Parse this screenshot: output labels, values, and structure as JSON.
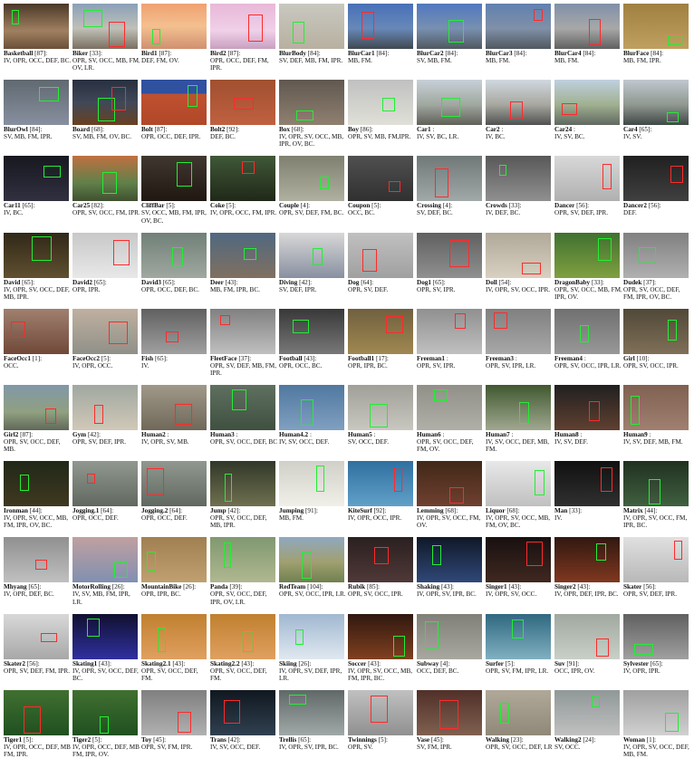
{
  "colors": {
    "box_green": "#22ee33",
    "box_red": "#ff2a2a"
  },
  "sequences": [
    {
      "name": "Basketball",
      "frames": "[87]:",
      "attrs": "IV, OPR, OCC, DEF, BC.",
      "bg": "linear-gradient(#4a3828,#a08060 60%,#6a5038)",
      "boxes": [
        "green"
      ]
    },
    {
      "name": "Biker",
      "frames": "[33]:",
      "attrs": "OPR, SV, OCC, MB, FM, OV, LR.",
      "bg": "linear-gradient(#8aa0b8,#c0c0b8 55%,#7a7060)",
      "boxes": [
        "green",
        "red"
      ]
    },
    {
      "name": "Bird1",
      "frames": "[87]:",
      "attrs": "DEF, FM, OV.",
      "bg": "linear-gradient(#f0a070,#f4c090 50%,#d09070)",
      "boxes": [
        "green"
      ]
    },
    {
      "name": "Bird2",
      "frames": "[87]:",
      "attrs": "OPR, OCC, DEF, FM, IPR.",
      "bg": "linear-gradient(#e8b8d8,#f0d0e8 60%,#c8a0c0)",
      "boxes": [
        "red"
      ]
    },
    {
      "name": "BlurBody",
      "frames": "[84]:",
      "attrs": "SV, DEF, MB, FM, IPR.",
      "bg": "linear-gradient(#c8c8c0,#b8b0a0)",
      "boxes": [
        "green"
      ]
    },
    {
      "name": "BlurCar1",
      "frames": "[84]:",
      "attrs": "MB, FM.",
      "bg": "linear-gradient(#4870b8,#6888b8 55%,#404850)",
      "boxes": [
        "red"
      ]
    },
    {
      "name": "BlurCar2",
      "frames": "[84]:",
      "attrs": "SV, MB, FM.",
      "bg": "linear-gradient(#5078c0,#7890b0 55%,#505860)",
      "boxes": [
        "green"
      ]
    },
    {
      "name": "BlurCar3",
      "frames": "[84]:",
      "attrs": "MB, FM.",
      "bg": "linear-gradient(#6080b0,#8090a8 55%,#505860)",
      "boxes": [
        "red"
      ]
    },
    {
      "name": "BlurCar4",
      "frames": "[84]:",
      "attrs": "MB, FM.",
      "bg": "linear-gradient(#8090a8,#a8a8a8 55%,#606060)",
      "boxes": [
        "red"
      ]
    },
    {
      "name": "BlurFace",
      "frames": "[84]:",
      "attrs": "MB, FM, IPR.",
      "bg": "linear-gradient(#a08040,#c0a060)",
      "boxes": [
        "green"
      ]
    },
    {
      "name": "BlurOwl",
      "frames": "[84]:",
      "attrs": "SV, MB, FM, IPR.",
      "bg": "linear-gradient(#606870,#8890a0)",
      "boxes": [
        "green"
      ]
    },
    {
      "name": "Board",
      "frames": "[68]:",
      "attrs": "SV, MB, FM, OV, BC.",
      "bg": "linear-gradient(#283040,#404858 50%,#6a4020)",
      "boxes": [
        "green",
        "red"
      ]
    },
    {
      "name": "Bolt",
      "frames": "[87]:",
      "attrs": "OPR, OCC, DEF, IPR.",
      "bg": "linear-gradient(#3050a0 30%,#c05030 32%,#b04828)",
      "boxes": [
        "green"
      ]
    },
    {
      "name": "Bolt2",
      "frames": "[92]:",
      "attrs": "DEF, BC.",
      "bg": "linear-gradient(#a05030,#c06040)",
      "boxes": [
        "red"
      ]
    },
    {
      "name": "Box",
      "frames": "[68]:",
      "attrs": "IV, OPR, SV, OCC, MB, IPR, OV, BC.",
      "bg": "linear-gradient(#605850,#908070)",
      "boxes": [
        "green"
      ]
    },
    {
      "name": "Boy",
      "frames": "[86]:",
      "attrs": "OPR, SV, MB, FM,IPR.",
      "bg": "linear-gradient(#c0c0c0,#e0e0d8)",
      "boxes": [
        "green"
      ]
    },
    {
      "name": "Car1",
      "frames": ":",
      "attrs": "IV, SV, BC, LR.",
      "bg": "linear-gradient(#c8d0d8,#a0a8a0 55%,#606058)",
      "boxes": [
        "green"
      ]
    },
    {
      "name": "Car2",
      "frames": ":",
      "attrs": "IV, BC.",
      "bg": "linear-gradient(#d0d8e0,#a8a8a0 55%,#505050)",
      "boxes": [
        "red"
      ]
    },
    {
      "name": "Car24",
      "frames": ":",
      "attrs": "IV, SV, BC.",
      "bg": "linear-gradient(#c0d0e0,#a0b090 55%,#606860)",
      "boxes": [
        "red"
      ]
    },
    {
      "name": "Car4",
      "frames": "[65]:",
      "attrs": "IV, SV.",
      "bg": "linear-gradient(#c0c8d0,#909890 55%,#404848)",
      "boxes": [
        "green"
      ]
    },
    {
      "name": "Car11",
      "frames": "[65]:",
      "attrs": "IV, BC.",
      "bg": "linear-gradient(#181820,#303040)",
      "boxes": [
        "green"
      ]
    },
    {
      "name": "Car25",
      "frames": "[82]:",
      "attrs": "OPR, SV, OCC, FM, IPR.",
      "bg": "linear-gradient(#c07040,#60804a 60%,#405030)",
      "boxes": [
        "green"
      ]
    },
    {
      "name": "CliffBar",
      "frames": "[5]:",
      "attrs": "SV, OCC, MB, FM, IPR, OV, BC.",
      "bg": "linear-gradient(#403830,#201810)",
      "boxes": [
        "green"
      ]
    },
    {
      "name": "Coke",
      "frames": "[5]:",
      "attrs": "IV, OPR, OCC, FM, IPR.",
      "bg": "linear-gradient(#405838,#202818)",
      "boxes": [
        "red"
      ]
    },
    {
      "name": "Couple",
      "frames": "[4]:",
      "attrs": "OPR, SV, DEF, FM, BC.",
      "bg": "linear-gradient(#808070,#b0b0a0)",
      "boxes": [
        "green"
      ]
    },
    {
      "name": "Coupon",
      "frames": "[5]:",
      "attrs": "OCC, BC.",
      "bg": "linear-gradient(#505050,#303030)",
      "boxes": [
        "red"
      ]
    },
    {
      "name": "Crossing",
      "frames": "[4]:",
      "attrs": "SV, DEF, BC.",
      "bg": "linear-gradient(#707878,#a0a8a8)",
      "boxes": [
        "red"
      ]
    },
    {
      "name": "Crowds",
      "frames": "[33]:",
      "attrs": "IV, DEF, BC.",
      "bg": "linear-gradient(#585858,#909090)",
      "boxes": [
        "green"
      ]
    },
    {
      "name": "Dancer",
      "frames": "[56]:",
      "attrs": "OPR, SV, DEF, IPR.",
      "bg": "linear-gradient(#d8d8d8,#b0b0b0)",
      "boxes": [
        "red"
      ]
    },
    {
      "name": "Dancer2",
      "frames": "[56]:",
      "attrs": "DEF.",
      "bg": "linear-gradient(#202020,#404040)",
      "boxes": [
        "red"
      ]
    },
    {
      "name": "David",
      "frames": "[65]:",
      "attrs": "IV, OPR, SV, OCC, DEF, MB, IPR.",
      "bg": "linear-gradient(#302818,#605030)",
      "boxes": [
        "green"
      ]
    },
    {
      "name": "David2",
      "frames": "[65]:",
      "attrs": "OPR, IPR.",
      "bg": "linear-gradient(#c8c8c8,#e8e8e8)",
      "boxes": [
        "red"
      ]
    },
    {
      "name": "David3",
      "frames": "[65]:",
      "attrs": "OPR, OCC, DEF, BC.",
      "bg": "linear-gradient(#708078,#a0a8a0)",
      "boxes": [
        "green"
      ]
    },
    {
      "name": "Deer",
      "frames": "[43]:",
      "attrs": "MB, FM, IPR, BC.",
      "bg": "linear-gradient(#506880,#807060)",
      "boxes": [
        "green"
      ]
    },
    {
      "name": "Diving",
      "frames": "[42]:",
      "attrs": "SV, DEF, IPR.",
      "bg": "linear-gradient(#d8d8d8,#8890a0)",
      "boxes": [
        "green"
      ]
    },
    {
      "name": "Dog",
      "frames": "[64]:",
      "attrs": "OPR, SV, DEF.",
      "bg": "linear-gradient(#c0c0c0,#a0a0a0)",
      "boxes": [
        "red"
      ]
    },
    {
      "name": "Dog1",
      "frames": "[65]:",
      "attrs": "OPR, SV, IPR.",
      "bg": "linear-gradient(#606060,#909090)",
      "boxes": [
        "red"
      ]
    },
    {
      "name": "Doll",
      "frames": "[54]:",
      "attrs": "IV, OPR, SV, OCC, IPR.",
      "bg": "linear-gradient(#b0a898,#d8d0c0)",
      "boxes": [
        "red"
      ]
    },
    {
      "name": "DragonBaby",
      "frames": "[33]:",
      "attrs": "OPR, SV, OCC, MB, FM, IPR, OV.",
      "bg": "linear-gradient(#407030,#80a040)",
      "boxes": [
        "green"
      ]
    },
    {
      "name": "Dudek",
      "frames": "[37]:",
      "attrs": "OPR, SV, OCC, DEF, FM, IPR, OV, BC.",
      "bg": "linear-gradient(#808080,#b0b0b0)",
      "boxes": [
        "green"
      ]
    },
    {
      "name": "FaceOcc1",
      "frames": "[1]:",
      "attrs": "OCC.",
      "bg": "linear-gradient(#a08070,#704838)",
      "boxes": [
        "red"
      ]
    },
    {
      "name": "FaceOcc2",
      "frames": "[5]:",
      "attrs": "IV, OPR, OCC.",
      "bg": "linear-gradient(#c0b0a0,#909088)",
      "boxes": [
        "red"
      ]
    },
    {
      "name": "Fish",
      "frames": "[65]:",
      "attrs": "IV.",
      "bg": "linear-gradient(#606060,#a0a0a0)",
      "boxes": [
        "red"
      ]
    },
    {
      "name": "FleetFace",
      "frames": "[37]:",
      "attrs": "OPR, SV, DEF, MB, FM, IPR.",
      "bg": "linear-gradient(#808080,#c0c0c0)",
      "boxes": [
        "red"
      ]
    },
    {
      "name": "Football",
      "frames": "[43]:",
      "attrs": "OPR, OCC, BC.",
      "bg": "linear-gradient(#383838,#787878)",
      "boxes": [
        "green"
      ]
    },
    {
      "name": "Football1",
      "frames": "[17]:",
      "attrs": "OPR, IPR, BC.",
      "bg": "linear-gradient(#706040,#a08850)",
      "boxes": [
        "red"
      ]
    },
    {
      "name": "Freeman1",
      "frames": ":",
      "attrs": "OPR, SV, IPR.",
      "bg": "linear-gradient(#909090,#c0c0c0)",
      "boxes": [
        "red"
      ]
    },
    {
      "name": "Freeman3",
      "frames": ":",
      "attrs": "OPR, SV, IPR, LR.",
      "bg": "linear-gradient(#808080,#a8a8a8)",
      "boxes": [
        "red"
      ]
    },
    {
      "name": "Freeman4",
      "frames": ":",
      "attrs": "OPR, SV, OCC, IPR, LR.",
      "bg": "linear-gradient(#707070,#989898)",
      "boxes": [
        "green"
      ]
    },
    {
      "name": "Girl",
      "frames": "[10]:",
      "attrs": "OPR, SV, OCC, IPR.",
      "bg": "linear-gradient(#504838,#807058)",
      "boxes": [
        "green"
      ]
    },
    {
      "name": "Girl2",
      "frames": "[87]:",
      "attrs": "OPR, SV, OCC, DEF, MB.",
      "bg": "linear-gradient(#8098a8,#90a080 60%,#606858)",
      "boxes": [
        "red"
      ]
    },
    {
      "name": "Gym",
      "frages": "",
      "frames": "[42]:",
      "attrs": "OPR, SV, DEF, IPR.",
      "bg": "linear-gradient(#a0a8a0,#d0c8b8)",
      "boxes": [
        "red"
      ]
    },
    {
      "name": "Human2",
      "frames": ":",
      "attrs": "IV, OPR, SV, MB.",
      "bg": "linear-gradient(#a09888,#706858)",
      "boxes": [
        "red"
      ]
    },
    {
      "name": "Human3",
      "frames": ":",
      "attrs": "OPR, SV, OCC, DEF, BC.",
      "bg": "linear-gradient(#607060,#405040)",
      "boxes": [
        "green"
      ]
    },
    {
      "name": "Human4.2",
      "frames": ":",
      "attrs": "IV, SV, OCC, DEF.",
      "bg": "linear-gradient(#5078a0,#80a0c0)",
      "boxes": [
        "green"
      ]
    },
    {
      "name": "Human5",
      "frames": ":",
      "attrs": "SV, OCC, DEF.",
      "bg": "linear-gradient(#a0a098,#c8c8c0)",
      "boxes": [
        "green"
      ]
    },
    {
      "name": "Human6",
      "frames": ":",
      "attrs": "OPR, SV, OCC, DEF, FM, OV.",
      "bg": "linear-gradient(#909088,#b0b0a8)",
      "boxes": [
        "green"
      ]
    },
    {
      "name": "Human7",
      "frames": ":",
      "attrs": "IV, SV, OCC, DEF, MB, FM.",
      "bg": "linear-gradient(#405830,#a0a890)",
      "boxes": [
        "green"
      ]
    },
    {
      "name": "Human8",
      "frames": ":",
      "attrs": "IV, SV, DEF.",
      "bg": "linear-gradient(#202020,#604030)",
      "boxes": [
        "red"
      ]
    },
    {
      "name": "Human9",
      "frames": ":",
      "attrs": "IV, SV, DEF, MB, FM.",
      "bg": "linear-gradient(#806050,#a08070)",
      "boxes": [
        "green"
      ]
    },
    {
      "name": "Ironman",
      "frames": "[44]:",
      "attrs": "IV, OPR, SV, OCC, MB, FM, IPR, OV, BC.",
      "bg": "linear-gradient(#202818,#403820)",
      "boxes": [
        "green"
      ]
    },
    {
      "name": "Jogging.1",
      "frames": "[64]:",
      "attrs": "OPR, OCC, DEF.",
      "bg": "linear-gradient(#909890,#606860)",
      "boxes": [
        "red"
      ]
    },
    {
      "name": "Jogging.2",
      "frames": "[64]:",
      "attrs": "OPR, OCC, DEF.",
      "bg": "linear-gradient(#909890,#606860)",
      "boxes": [
        "red"
      ]
    },
    {
      "name": "Jump",
      "frames": "[42]:",
      "attrs": "OPR, SV, OCC, DEF, MB, IPR.",
      "bg": "linear-gradient(#303828,#707050)",
      "boxes": [
        "green"
      ]
    },
    {
      "name": "Jumping",
      "frames": "[91]:",
      "attrs": "MB, FM.",
      "bg": "linear-gradient(#d0d0c8,#f0f0e8)",
      "boxes": [
        "green"
      ]
    },
    {
      "name": "KiteSurf",
      "frames": "[92]:",
      "attrs": "IV, OPR, OCC, IPR.",
      "bg": "linear-gradient(#3070a0,#60a0c8)",
      "boxes": [
        "red"
      ]
    },
    {
      "name": "Lemming",
      "frames": "[68]:",
      "attrs": "IV, OPR, SV, OCC, FM, OV.",
      "bg": "linear-gradient(#402818,#704030)",
      "boxes": [
        "red"
      ]
    },
    {
      "name": "Liquor",
      "frames": "[68]:",
      "attrs": "IV, OPR, SV, OCC, MB, FM, OV, BC.",
      "bg": "linear-gradient(#e8e8e8,#c0c0c0)",
      "boxes": [
        "green"
      ]
    },
    {
      "name": "Man",
      "frames": "[33]:",
      "attrs": "IV.",
      "bg": "linear-gradient(#101010,#303030)",
      "boxes": [
        "red"
      ]
    },
    {
      "name": "Matrix",
      "frames": "[44]:",
      "attrs": "IV, OPR, SV, OCC, FM, IPR, BC.",
      "bg": "linear-gradient(#203020,#406040)",
      "boxes": [
        "green"
      ]
    },
    {
      "name": "Mhyang",
      "frames": "[65]:",
      "attrs": "IV, OPR, DEF, BC.",
      "bg": "linear-gradient(#909090,#c0c0c0)",
      "boxes": [
        "red"
      ]
    },
    {
      "name": "MotorRolling",
      "frames": "[26]:",
      "attrs": "IV, SV, MB, FM, IPR, LR.",
      "bg": "linear-gradient(#c0a0a0,#8090b0)",
      "boxes": [
        "green"
      ]
    },
    {
      "name": "MountainBike",
      "frames": "[26]:",
      "attrs": "OPR, IPR, BC.",
      "bg": "linear-gradient(#a08050,#c0a070)",
      "boxes": [
        "green"
      ]
    },
    {
      "name": "Panda",
      "frames": "[39]:",
      "attrs": "OPR, SV, OCC, DEF, IPR, OV, LR.",
      "bg": "linear-gradient(#809870,#b0b890)",
      "boxes": [
        "green"
      ]
    },
    {
      "name": "RedTeam",
      "frames": "[104]:",
      "attrs": "OPR, SV, OCC, IPR, LR.",
      "bg": "linear-gradient(#90a8c0,#a0a070 55%,#708050)",
      "boxes": [
        "green"
      ]
    },
    {
      "name": "Rubik",
      "frames": "[85]:",
      "attrs": "OPR, SV, OCC, IPR.",
      "bg": "linear-gradient(#2a2020,#503838)",
      "boxes": [
        "red"
      ]
    },
    {
      "name": "Shaking",
      "frames": "[43]:",
      "attrs": "IV, OPR, SV, IPR, BC.",
      "bg": "linear-gradient(#101828,#304878)",
      "boxes": [
        "green"
      ]
    },
    {
      "name": "Singer1",
      "frames": "[43]:",
      "attrs": "IV, OPR, SV, OCC.",
      "bg": "linear-gradient(#181010,#402820)",
      "boxes": [
        "red"
      ]
    },
    {
      "name": "Singer2",
      "frames": "[43]:",
      "attrs": "IV, OPR, DEF, IPR, BC.",
      "bg": "linear-gradient(#301810,#803820)",
      "boxes": [
        "green"
      ]
    },
    {
      "name": "Skater",
      "frames": "[56]:",
      "attrs": "OPR, SV, DEF, IPR.",
      "bg": "linear-gradient(#e0e0e0,#b8b8b8)",
      "boxes": [
        "red"
      ]
    },
    {
      "name": "Skater2",
      "frames": "[56]:",
      "attrs": "OPR, SV, DEF, FM, IPR.",
      "bg": "linear-gradient(#d8d8d8,#a8a8a8)",
      "boxes": [
        "red"
      ]
    },
    {
      "name": "Skating1",
      "frames": "[43]:",
      "attrs": "IV, OPR, SV, OCC, DEF, BC.",
      "bg": "linear-gradient(#101030,#3030a0)",
      "boxes": [
        "green"
      ]
    },
    {
      "name": "Skating2.1",
      "frames": "[43]:",
      "attrs": "OPR, SV, OCC, DEF, FM.",
      "bg": "linear-gradient(#c08030,#e0a060)",
      "boxes": [
        "green"
      ]
    },
    {
      "name": "Skating2.2",
      "frames": "[43]:",
      "attrs": "OPR, SV, OCC, DEF, FM.",
      "bg": "linear-gradient(#c08030,#e0a060)",
      "boxes": [
        "green"
      ]
    },
    {
      "name": "Skiing",
      "frames": "[26]:",
      "attrs": "IV, OPR, SV, DEF, IPR, LR.",
      "bg": "linear-gradient(#a0b8d0,#e0e8f0)",
      "boxes": [
        "green"
      ]
    },
    {
      "name": "Soccer",
      "frames": "[43]:",
      "attrs": "IV, OPR, SV, OCC, MB, FM, IPR, BC.",
      "bg": "linear-gradient(#301810,#804020)",
      "boxes": [
        "green"
      ]
    },
    {
      "name": "Subway",
      "frames": "[4]:",
      "attrs": "OCC, DEF, BC.",
      "bg": "linear-gradient(#808078,#a8a8a0)",
      "boxes": [
        "green"
      ]
    },
    {
      "name": "Surfer",
      "frames": "[5]:",
      "attrs": "OPR, SV, FM, IPR, LR.",
      "bg": "linear-gradient(#306880,#80b0c0)",
      "boxes": [
        "green"
      ]
    },
    {
      "name": "Suv",
      "frames": "[91]:",
      "attrs": "OCC, IPR, OV.",
      "bg": "linear-gradient(#a0a8a0,#c8d0c8)",
      "boxes": [
        "red"
      ]
    },
    {
      "name": "Sylvester",
      "frames": "[65]:",
      "attrs": "IV, OPR, IPR.",
      "bg": "linear-gradient(#606060,#a0a0a0)",
      "boxes": [
        "green"
      ]
    },
    {
      "name": "Tiger1",
      "frames": "[5]:",
      "attrs": "IV, OPR, OCC, DEF, MB, FM, IPR.",
      "bg": "linear-gradient(#407030,#205020)",
      "boxes": [
        "red"
      ]
    },
    {
      "name": "Tiger2",
      "frames": "[5]:",
      "attrs": "IV, OPR, OCC, DEF, MB, FM, IPR, OV.",
      "bg": "linear-gradient(#407030,#205020)",
      "boxes": [
        "green"
      ]
    },
    {
      "name": "Toy",
      "frames": "[45]:",
      "attrs": "OPR, SV, FM, IPR.",
      "bg": "linear-gradient(#808080,#b0b0b0)",
      "boxes": [
        "red"
      ]
    },
    {
      "name": "Trans",
      "frames": "[42]:",
      "attrs": "IV, SV, OCC, DEF.",
      "bg": "linear-gradient(#101820,#304050)",
      "boxes": [
        "red"
      ]
    },
    {
      "name": "Trellis",
      "frames": "[65]:",
      "attrs": "IV, OPR, SV, IPR, BC.",
      "bg": "linear-gradient(#606868,#a0a8a8)",
      "boxes": [
        "green"
      ]
    },
    {
      "name": "Twinnings",
      "frames": "[5]:",
      "attrs": "OPR, SV.",
      "bg": "linear-gradient(#c0c0c0,#909090)",
      "boxes": [
        "red"
      ]
    },
    {
      "name": "Vase",
      "frames": "[45]:",
      "attrs": "SV, FM, IPR.",
      "bg": "linear-gradient(#503028,#806050)",
      "boxes": [
        "red"
      ]
    },
    {
      "name": "Walking",
      "frames": "[23]:",
      "attrs": "OPR, SV, OCC, DEF, LR.",
      "bg": "linear-gradient(#b0a898,#908878)",
      "boxes": [
        "green"
      ]
    },
    {
      "name": "Walking2",
      "frames": "[24]:",
      "attrs": "SV, OCC.",
      "bg": "linear-gradient(#909898,#c0c0c0)",
      "boxes": [
        "green"
      ]
    },
    {
      "name": "Woman",
      "frames": "[1]:",
      "attrs": "IV, OPR, SV, OCC, DEF, MB, FM.",
      "bg": "linear-gradient(#a0a0a0,#d0d0d0)",
      "boxes": [
        "green"
      ]
    }
  ]
}
